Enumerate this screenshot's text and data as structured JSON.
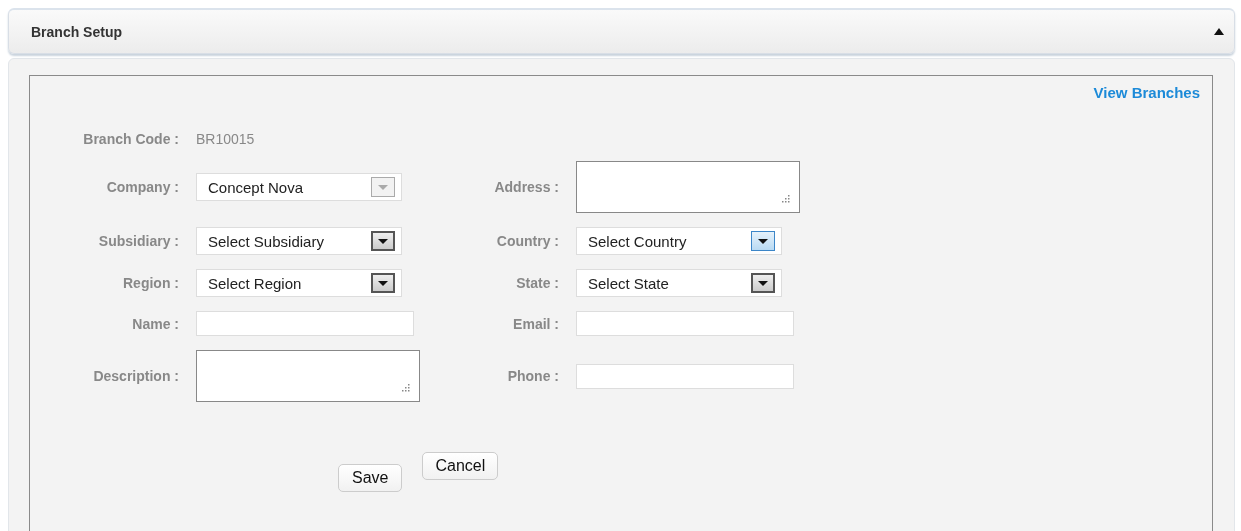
{
  "panel": {
    "title": "Branch Setup",
    "expanded": true
  },
  "link": "View Branches",
  "branch_code": {
    "label": "Branch Code :",
    "value": "BR10015"
  },
  "rows": [
    {
      "left": {
        "label": "Company :",
        "kind": "select",
        "value": "Concept Nova",
        "disabled": true,
        "focused": false
      },
      "right": {
        "label": "Address :",
        "kind": "textarea"
      }
    },
    {
      "left": {
        "label": "Subsidiary :",
        "kind": "select",
        "value": "Select Subsidiary",
        "disabled": false,
        "focused": false
      },
      "right": {
        "label": "Country :",
        "kind": "select",
        "value": "Select Country",
        "disabled": false,
        "focused": true
      }
    },
    {
      "left": {
        "label": "Region :",
        "kind": "select",
        "value": "Select Region",
        "disabled": false,
        "focused": false
      },
      "right": {
        "label": "State :",
        "kind": "select",
        "value": "Select State",
        "disabled": false,
        "focused": false
      }
    },
    {
      "left": {
        "label": "Name :",
        "kind": "text"
      },
      "right": {
        "label": "Email :",
        "kind": "text"
      }
    },
    {
      "left": {
        "label": "Description :",
        "kind": "textarea"
      },
      "right": {
        "label": "Phone :",
        "kind": "text"
      }
    }
  ],
  "buttons": [
    "Save",
    "Cancel"
  ]
}
